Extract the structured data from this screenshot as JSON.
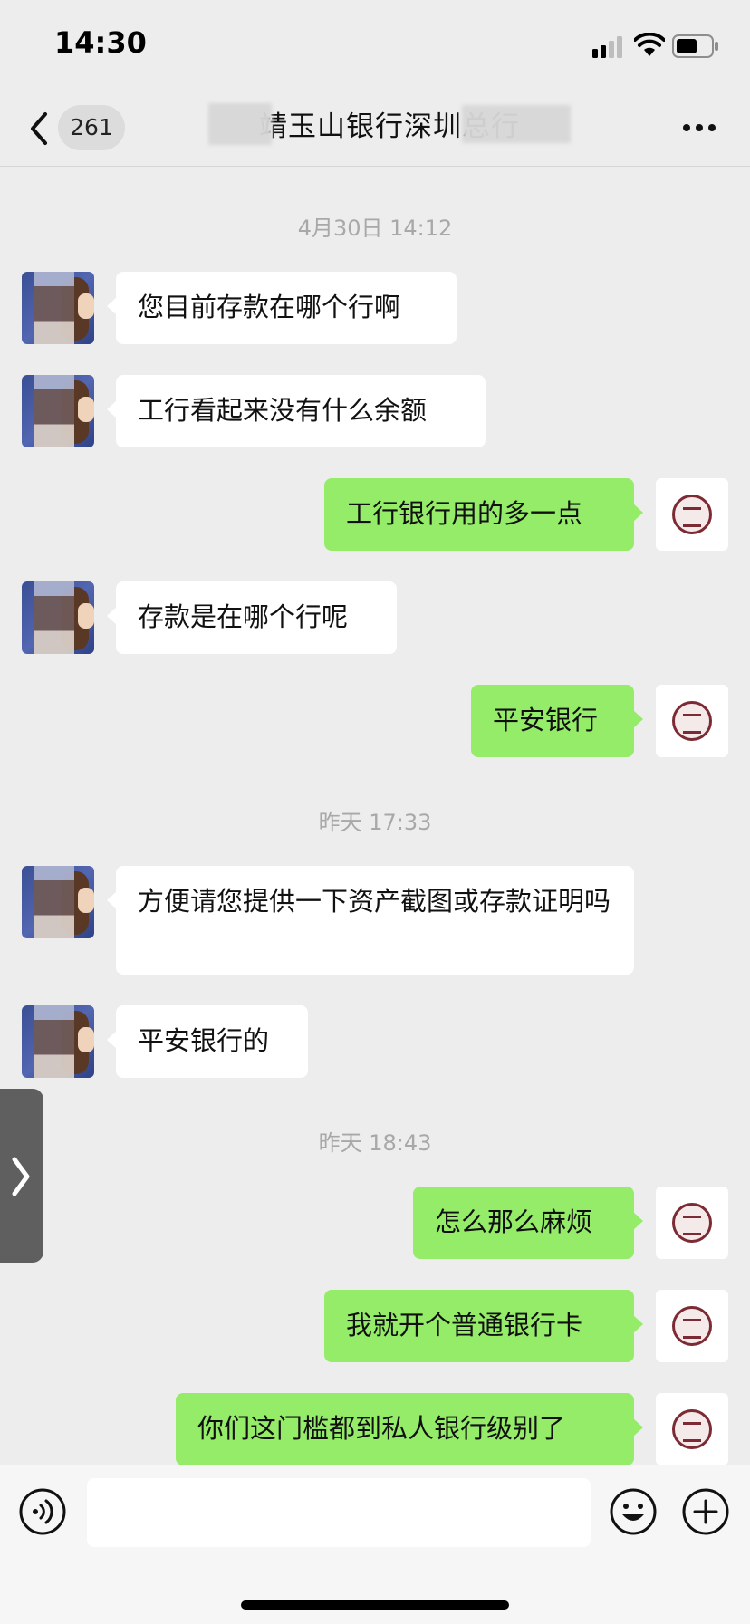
{
  "status_bar": {
    "time": "14:30"
  },
  "nav": {
    "unread_count": "261",
    "title": "靖玉山银行深圳总行"
  },
  "messages": [
    {
      "type": "time",
      "text": "4月30日 14:12"
    },
    {
      "type": "other",
      "text": "您目前存款在哪个行啊"
    },
    {
      "type": "other",
      "text": "工行看起来没有什么余额"
    },
    {
      "type": "self",
      "text": "工行银行用的多一点"
    },
    {
      "type": "other",
      "text": "存款是在哪个行呢"
    },
    {
      "type": "self",
      "text": "平安银行"
    },
    {
      "type": "time",
      "text": "昨天 17:33"
    },
    {
      "type": "other",
      "text": "方便请您提供一下资产截图或存款证明吗"
    },
    {
      "type": "other",
      "text": "平安银行的"
    },
    {
      "type": "time",
      "text": "昨天 18:43"
    },
    {
      "type": "self",
      "text": "怎么那么麻烦"
    },
    {
      "type": "self",
      "text": "我就开个普通银行卡"
    },
    {
      "type": "self",
      "text": "你们这门槛都到私人银行级别了"
    }
  ],
  "input": {
    "value": ""
  },
  "colors": {
    "self_bubble": "#95ec69",
    "other_bubble": "#ffffff",
    "background": "#ededed"
  }
}
